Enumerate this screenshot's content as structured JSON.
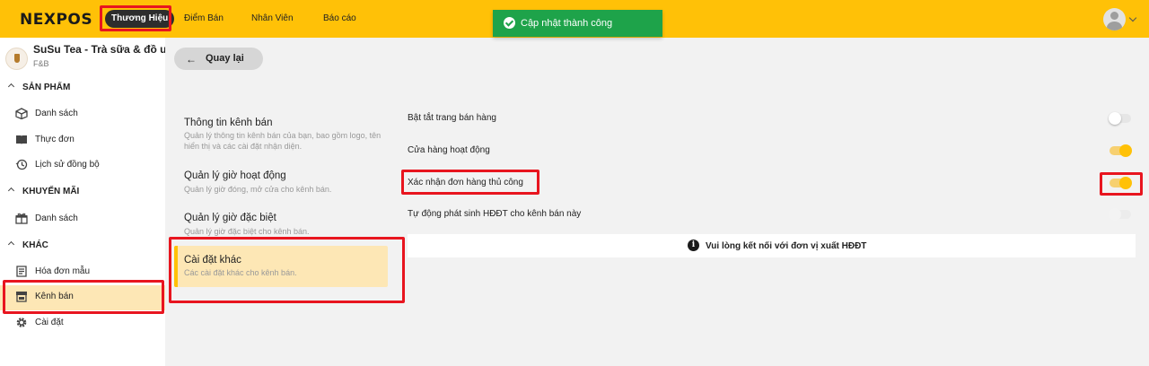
{
  "topbar": {
    "logo": "NEXPOS",
    "nav": [
      {
        "label": "Thương Hiệu",
        "active": true
      },
      {
        "label": "Điểm Bán"
      },
      {
        "label": "Nhân Viên"
      },
      {
        "label": "Báo cáo"
      }
    ],
    "toast": "Cập nhật thành công",
    "avatar_icon": "user-avatar-icon"
  },
  "sidebar": {
    "store_name": "SuSu Tea - Trà sữa & đồ uống",
    "store_category": "F&B",
    "sections": [
      {
        "title": "SẢN PHẨM",
        "items": [
          {
            "label": "Danh sách",
            "icon": "box-icon"
          },
          {
            "label": "Thực đơn",
            "icon": "book-icon"
          },
          {
            "label": "Lịch sử đồng bộ",
            "icon": "history-icon"
          }
        ]
      },
      {
        "title": "KHUYẾN MÃI",
        "items": [
          {
            "label": "Danh sách",
            "icon": "gift-icon"
          }
        ]
      },
      {
        "title": "KHÁC",
        "items": [
          {
            "label": "Hóa đơn mẫu",
            "icon": "receipt-icon"
          },
          {
            "label": "Kênh bán",
            "icon": "store-icon",
            "active": true
          },
          {
            "label": "Cài đặt",
            "icon": "gear-icon"
          }
        ]
      }
    ]
  },
  "back_button": "Quay lại",
  "settings_menu": [
    {
      "title": "Thông tin kênh bán",
      "desc": "Quản lý thông tin kênh bán của bạn, bao gồm logo, tên hiển thị và các cài đặt nhận diện."
    },
    {
      "title": "Quản lý giờ hoạt động",
      "desc": "Quản lý giờ đóng, mở cửa cho kênh bán."
    },
    {
      "title": "Quản lý giờ đặc biệt",
      "desc": "Quản lý giờ đặc biệt cho kênh bán."
    },
    {
      "title": "Cài đặt khác",
      "desc": "Các cài đặt khác cho kênh bán.",
      "active": true
    }
  ],
  "options": [
    {
      "label": "Bật tắt trang bán hàng",
      "state": "off"
    },
    {
      "label": "Cửa hàng hoạt động",
      "state": "on"
    },
    {
      "label": "Xác nhận đơn hàng thủ công",
      "state": "on"
    },
    {
      "label": "Tự động phát sinh HĐĐT cho kênh bán này",
      "state": "disabled"
    }
  ],
  "notice": "Vui lòng kết nối với đơn vị xuất HĐĐT",
  "colors": {
    "brand": "#ffc107",
    "toast": "#1ea34a",
    "highlight": "#e8151f",
    "active_bg": "#fde7b5"
  }
}
